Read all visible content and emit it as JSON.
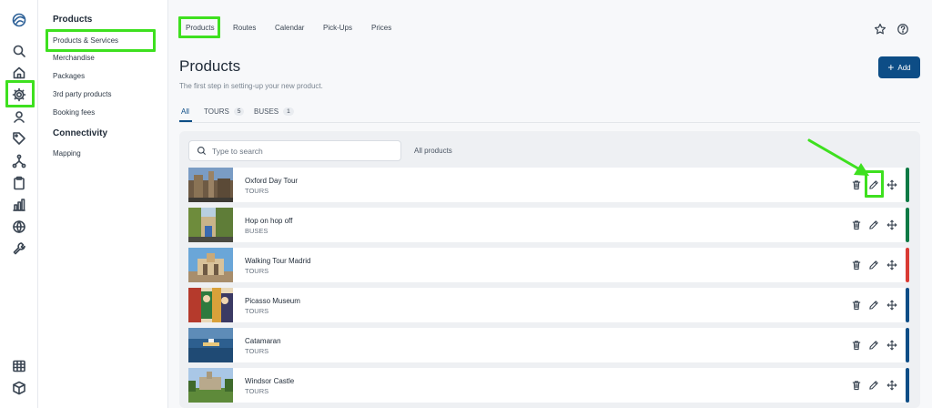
{
  "subnav": {
    "section_products": "Products",
    "products_items": [
      "Products & Services",
      "Merchandise",
      "Packages",
      "3rd party products",
      "Booking fees"
    ],
    "section_connectivity": "Connectivity",
    "connectivity_items": [
      "Mapping"
    ]
  },
  "topnav": [
    "Products",
    "Routes",
    "Calendar",
    "Pick-Ups",
    "Prices"
  ],
  "header": {
    "title": "Products",
    "subtitle": "The first step in setting-up your new product.",
    "add_label": "Add"
  },
  "tabs": [
    {
      "label": "All",
      "count": ""
    },
    {
      "label": "TOURS",
      "count": "5"
    },
    {
      "label": "BUSES",
      "count": "1"
    }
  ],
  "search": {
    "placeholder": "Type to search"
  },
  "filter": {
    "label": "All products"
  },
  "products": [
    {
      "name": "Oxford Day Tour",
      "type": "TOURS",
      "status_color": "#0f7a45"
    },
    {
      "name": "Hop on hop off",
      "type": "BUSES",
      "status_color": "#0f7a45"
    },
    {
      "name": "Walking Tour Madrid",
      "type": "TOURS",
      "status_color": "#d93b34"
    },
    {
      "name": "Picasso Museum",
      "type": "TOURS",
      "status_color": "#0d4d86"
    },
    {
      "name": "Catamaran",
      "type": "TOURS",
      "status_color": "#0d4d86"
    },
    {
      "name": "Windsor Castle",
      "type": "TOURS",
      "status_color": "#0d4d86"
    }
  ],
  "icons": {
    "rail": [
      "logo-icon",
      "search-icon",
      "home-icon",
      "gear-icon",
      "user-badge-icon",
      "tag-icon",
      "network-icon",
      "clipboard-icon",
      "bar-chart-icon",
      "globe-icon",
      "wrench-icon",
      "table-icon",
      "cube-icon"
    ],
    "actions": [
      "trash-icon",
      "pencil-icon",
      "move-icon"
    ],
    "top": [
      "star-icon",
      "help-icon"
    ]
  },
  "colors": {
    "accent": "#0d4d86",
    "highlight": "#3ee01f",
    "active": "#0f7a45",
    "inactive": "#d93b34"
  }
}
